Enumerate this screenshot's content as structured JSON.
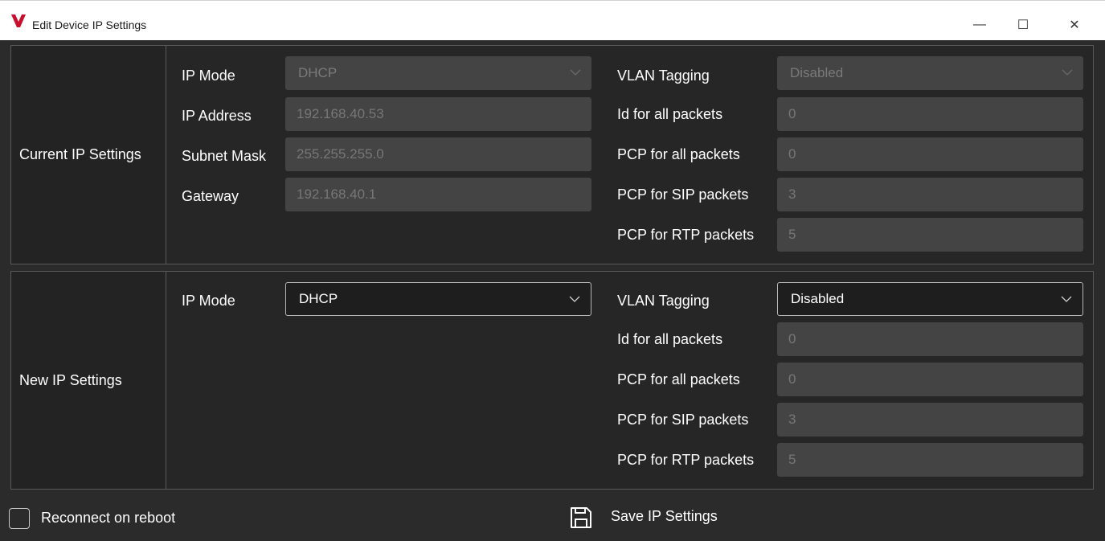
{
  "window": {
    "title": "Edit Device IP Settings",
    "logo": "V",
    "logo_color": "#c8102e",
    "minimize_glyph": "—",
    "maximize_glyph": "☐",
    "close_glyph": "✕"
  },
  "current": {
    "section_label": "Current IP Settings",
    "ip_mode_label": "IP Mode",
    "ip_mode_value": "DHCP",
    "ip_address_label": "IP Address",
    "ip_address_value": "192.168.40.53",
    "subnet_mask_label": "Subnet Mask",
    "subnet_mask_value": "255.255.255.0",
    "gateway_label": "Gateway",
    "gateway_value": "192.168.40.1",
    "vlan_tagging_label": "VLAN Tagging",
    "vlan_tagging_value": "Disabled",
    "id_all_label": "Id for all packets",
    "id_all_value": "0",
    "pcp_all_label": "PCP for all packets",
    "pcp_all_value": "0",
    "pcp_sip_label": "PCP for SIP packets",
    "pcp_sip_value": "3",
    "pcp_rtp_label": "PCP for RTP packets",
    "pcp_rtp_value": "5"
  },
  "new": {
    "section_label": "New IP Settings",
    "ip_mode_label": "IP Mode",
    "ip_mode_value": "DHCP",
    "vlan_tagging_label": "VLAN Tagging",
    "vlan_tagging_value": "Disabled",
    "id_all_label": "Id for all packets",
    "id_all_value": "0",
    "pcp_all_label": "PCP for all packets",
    "pcp_all_value": "0",
    "pcp_sip_label": "PCP for SIP packets",
    "pcp_sip_value": "3",
    "pcp_rtp_label": "PCP for RTP packets",
    "pcp_rtp_value": "5"
  },
  "footer": {
    "reconnect_label": "Reconnect on reboot",
    "reconnect_checked": false,
    "save_label": "Save IP Settings",
    "save_icon": "floppy-disk-icon"
  }
}
